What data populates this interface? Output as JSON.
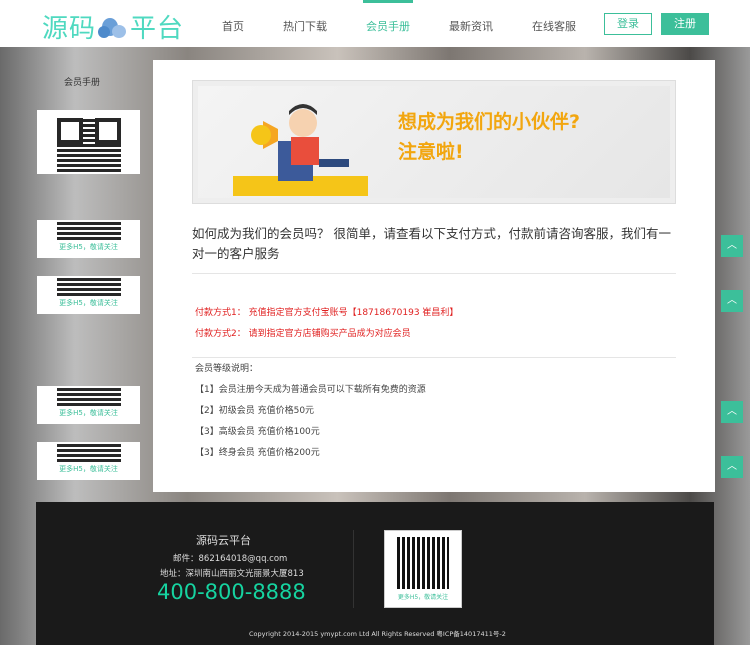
{
  "header": {
    "logo_left": "源码",
    "logo_right": "平台",
    "nav": [
      "首页",
      "热门下载",
      "会员手册",
      "最新资讯",
      "在线客服"
    ],
    "active_nav": 2,
    "login": "登录",
    "register": "注册"
  },
  "sidebar": {
    "title": "会员手册",
    "qr_caption": "更多H5，敬请关注"
  },
  "banner": {
    "line1": "想成为我们的小伙伴?",
    "line2": "注意啦!"
  },
  "main": {
    "intro": "如何成为我们的会员吗？ 很简单，请查看以下支付方式，付款前请咨询客服，我们有一对一的客户服务",
    "payments": [
      "付款方式1： 充值指定官方支付宝账号【18718670193 崔昌利】",
      "付款方式2： 请到指定官方店铺购买产品成为对应会员"
    ],
    "levels_title": "会员等级说明：",
    "levels": [
      "【1】会员注册今天成为普通会员可以下载所有免费的资源",
      "【2】初级会员 充值价格50元",
      "【3】高级会员 充值价格100元",
      "【3】终身会员 充值价格200元"
    ]
  },
  "footer": {
    "name": "源码云平台",
    "email": "邮件：862164018@qq.com",
    "address": "地址：深圳南山西丽文光丽景大厦813",
    "phone": "400-800-8888",
    "qr_caption": "更多H5，敬请关注",
    "copyright": "Copyright 2014-2015 ymypt.com Ltd All Rights Reserved 粤ICP备14017411号-2"
  },
  "colors": {
    "accent": "#3cbf9a",
    "red": "#e02020",
    "banner_text": "#f2a60f"
  }
}
